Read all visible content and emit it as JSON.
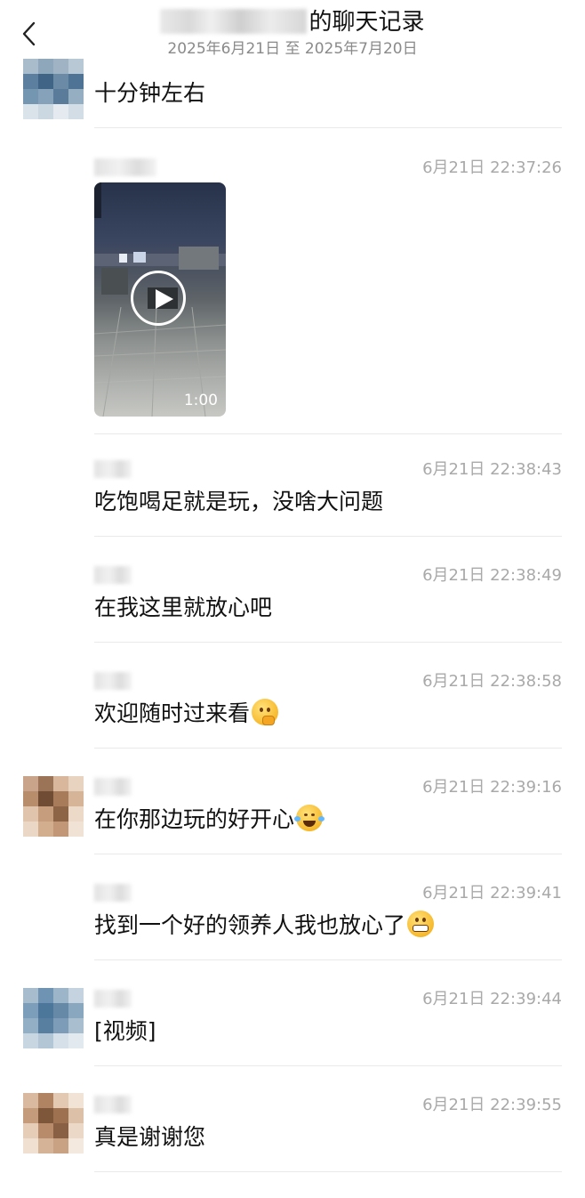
{
  "header": {
    "title_suffix": "的聊天记录",
    "date_range": "2025年6月21日 至 2025年7月20日"
  },
  "messages": [
    {
      "text": "十分钟左右"
    },
    {
      "time": "6月21日 22:37:26",
      "video": {
        "duration": "1:00"
      }
    },
    {
      "time": "6月21日 22:38:43",
      "text": "吃饱喝足就是玩，没啥大问题"
    },
    {
      "time": "6月21日 22:38:49",
      "text": "在我这里就放心吧"
    },
    {
      "time": "6月21日 22:38:58",
      "text": "欢迎随时过来看",
      "emoji": "thinking-face"
    },
    {
      "time": "6月21日 22:39:16",
      "text": "在你那边玩的好开心",
      "emoji": "tears-of-joy-face"
    },
    {
      "time": "6月21日 22:39:41",
      "text": "找到一个好的领养人我也放心了",
      "emoji": "grinning-face"
    },
    {
      "time": "6月21日 22:39:44",
      "text": "[视频]"
    },
    {
      "time": "6月21日 22:39:55",
      "text": "真是谢谢您"
    }
  ],
  "colors": {
    "timestamp": "#a9a9a9",
    "divider": "#e9e9e9",
    "subtitle": "#8a8a8a"
  }
}
